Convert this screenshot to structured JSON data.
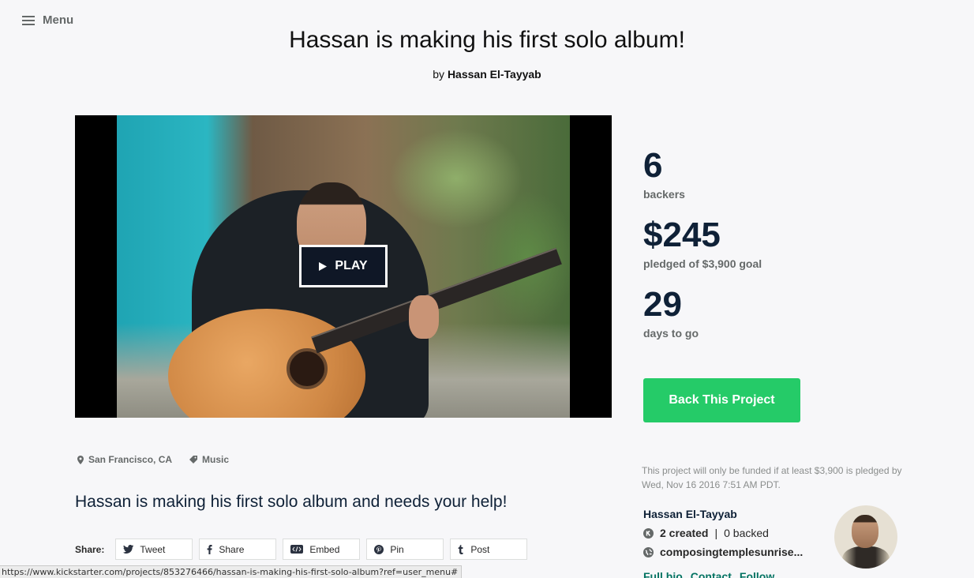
{
  "header": {
    "menu_label": "Menu"
  },
  "project": {
    "title": "Hassan is making his first solo album!",
    "by_prefix": "by",
    "creator_name": "Hassan El-Tayyab",
    "play_label": "PLAY",
    "blurb": "Hassan is making his first solo album and needs your help!",
    "location": "San Francisco, CA",
    "category": "Music"
  },
  "stats": {
    "backers_count": "6",
    "backers_label": "backers",
    "pledged_amount": "$245",
    "pledged_label": "pledged of $3,900 goal",
    "days_count": "29",
    "days_label": "days to go"
  },
  "back_button_label": "Back This Project",
  "funding_note": "This project will only be funded if at least $3,900 is pledged by Wed, Nov 16 2016 7:51 AM PDT.",
  "share": {
    "label": "Share:",
    "buttons": [
      {
        "label": "Tweet",
        "icon": "twitter-icon"
      },
      {
        "label": "Share",
        "icon": "facebook-icon"
      },
      {
        "label": "Embed",
        "icon": "embed-icon"
      },
      {
        "label": "Pin",
        "icon": "pinterest-icon"
      },
      {
        "label": "Post",
        "icon": "tumblr-icon"
      }
    ]
  },
  "creator": {
    "name": "Hassan El-Tayyab",
    "created": "2 created",
    "separator": "|",
    "backed": "0 backed",
    "website": "composingtemplesunrise..."
  },
  "creator_links": {
    "full_bio": "Full bio",
    "contact": "Contact",
    "follow": "Follow"
  },
  "status_bar_url": "https://www.kickstarter.com/projects/853276466/hassan-is-making-his-first-solo-album?ref=user_menu#",
  "colors": {
    "accent_green": "#25cb68",
    "heading_navy": "#0f2137",
    "muted_gray": "#656969"
  }
}
